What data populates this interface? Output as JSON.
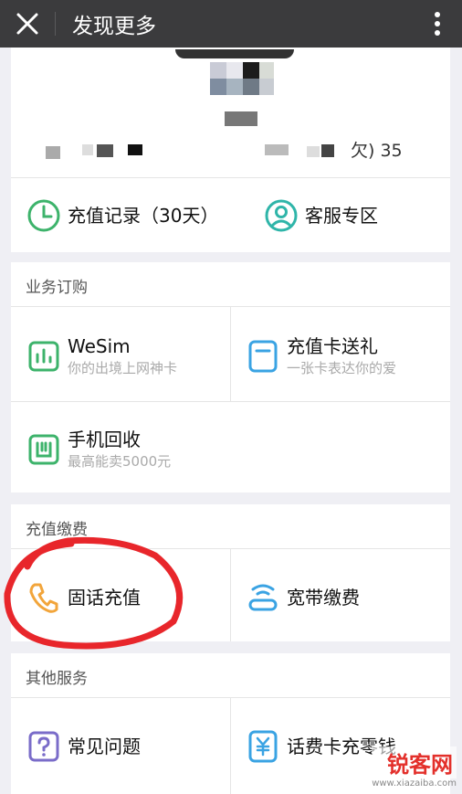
{
  "header": {
    "title": "发现更多"
  },
  "account": {
    "visible_text": "欠) 35"
  },
  "top_actions": [
    {
      "label": "充值记录（30天）"
    },
    {
      "label": "客服专区"
    }
  ],
  "sections": {
    "business": {
      "title": "业务订购",
      "items": [
        {
          "name": "WeSim",
          "sub": "你的出境上网神卡"
        },
        {
          "name": "充值卡送礼",
          "sub": "一张卡表达你的爱"
        },
        {
          "name": "手机回收",
          "sub": "最高能卖5000元"
        }
      ]
    },
    "recharge": {
      "title": "充值缴费",
      "items": [
        {
          "name": "固话充值"
        },
        {
          "name": "宽带缴费"
        }
      ]
    },
    "other": {
      "title": "其他服务",
      "items": [
        {
          "name": "常见问题"
        },
        {
          "name": "话费卡充零钱"
        }
      ]
    }
  },
  "watermark": {
    "logo": "锐客网",
    "url": "www.xiazaiba.com"
  },
  "colors": {
    "topbar": "#3b3b3d",
    "green": "#3db36b",
    "teal": "#2fb5a9",
    "blue": "#3aa3e3",
    "orange": "#f2a53b",
    "purple": "#7a6cc9",
    "annotation_red": "#e8262b"
  }
}
